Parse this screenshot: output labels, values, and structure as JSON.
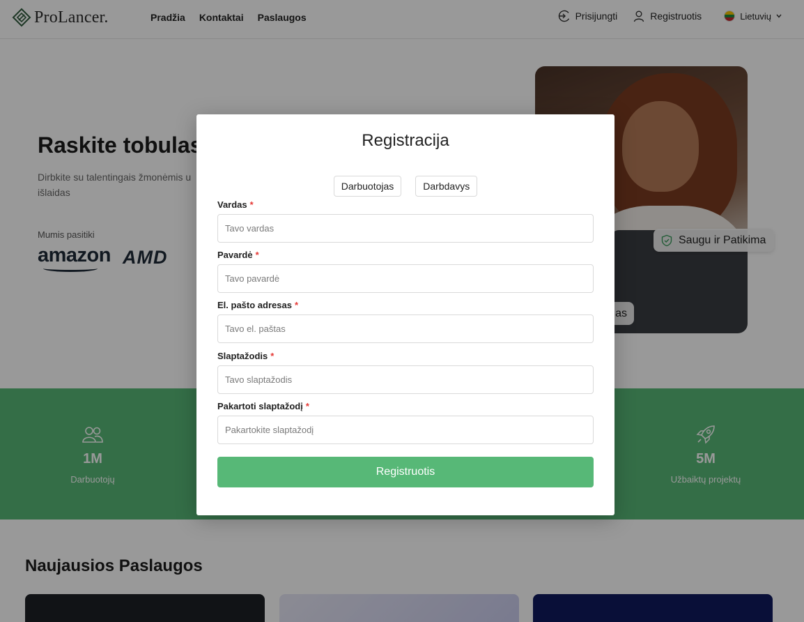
{
  "header": {
    "logo_text": "ProLancer.",
    "nav": [
      "Pradžia",
      "Kontaktai",
      "Paslaugos"
    ],
    "login_label": "Prisijungti",
    "register_label": "Registruotis",
    "language_label": "Lietuvių"
  },
  "hero": {
    "title": "Raskite tobulas",
    "subtitle": "Dirbkite su talentingais žmonėmis u išlaidas",
    "trusted_label": "Mumis pasitiki",
    "brands": [
      "amazon",
      "AMD"
    ],
    "badge_safe": "Saugu ir Patikima",
    "badge_bottom": "as"
  },
  "stats": [
    {
      "icon": "users-icon",
      "value": "1M",
      "label": "Darbuotojų"
    },
    {
      "icon": "rocket-icon",
      "value": "5M",
      "label": "Užbaiktų projektų"
    }
  ],
  "services": {
    "title": "Naujausios Paslaugos"
  },
  "modal": {
    "title": "Registracija",
    "roles": [
      "Darbuotojas",
      "Darbdavys"
    ],
    "fields": [
      {
        "label": "Vardas",
        "placeholder": "Tavo vardas",
        "required_mark": "*"
      },
      {
        "label": "Pavardė",
        "placeholder": "Tavo pavardė",
        "required_mark": "*"
      },
      {
        "label": "El. pašto adresas",
        "placeholder": "Tavo el. paštas",
        "required_mark": "*"
      },
      {
        "label": "Slaptažodis",
        "placeholder": "Tavo slaptažodis",
        "required_mark": "*"
      },
      {
        "label": "Pakartoti slaptažodį",
        "placeholder": "Pakartokite slaptažodį",
        "required_mark": "*"
      }
    ],
    "submit_label": "Registruotis"
  },
  "colors": {
    "accent_green": "#57b877",
    "required_red": "#e53935",
    "overlay": "rgba(0,0,0,0.4)"
  }
}
